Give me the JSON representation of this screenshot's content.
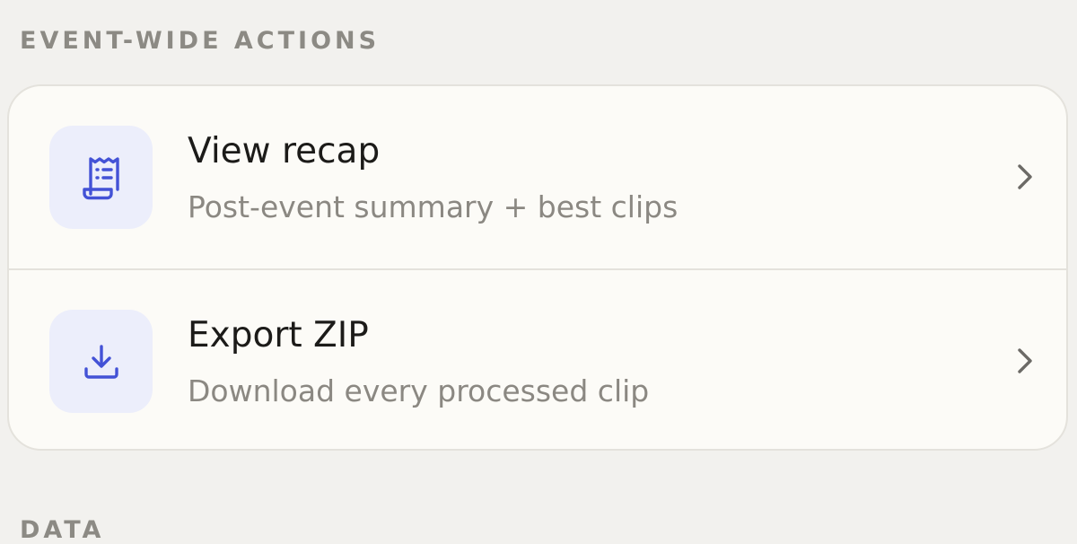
{
  "sections": {
    "event_wide": {
      "heading": "EVENT-WIDE ACTIONS"
    },
    "data": {
      "heading": "DATA"
    }
  },
  "actions": [
    {
      "title": "View recap",
      "subtitle": "Post-event summary + best clips",
      "icon": "receipt-icon"
    },
    {
      "title": "Export ZIP",
      "subtitle": "Download every processed clip",
      "icon": "download-icon"
    }
  ],
  "colors": {
    "accent": "#4352d6",
    "icon_tile_bg": "#eceefb",
    "page_bg": "#f2f1ee",
    "card_bg": "#fcfbf7"
  }
}
